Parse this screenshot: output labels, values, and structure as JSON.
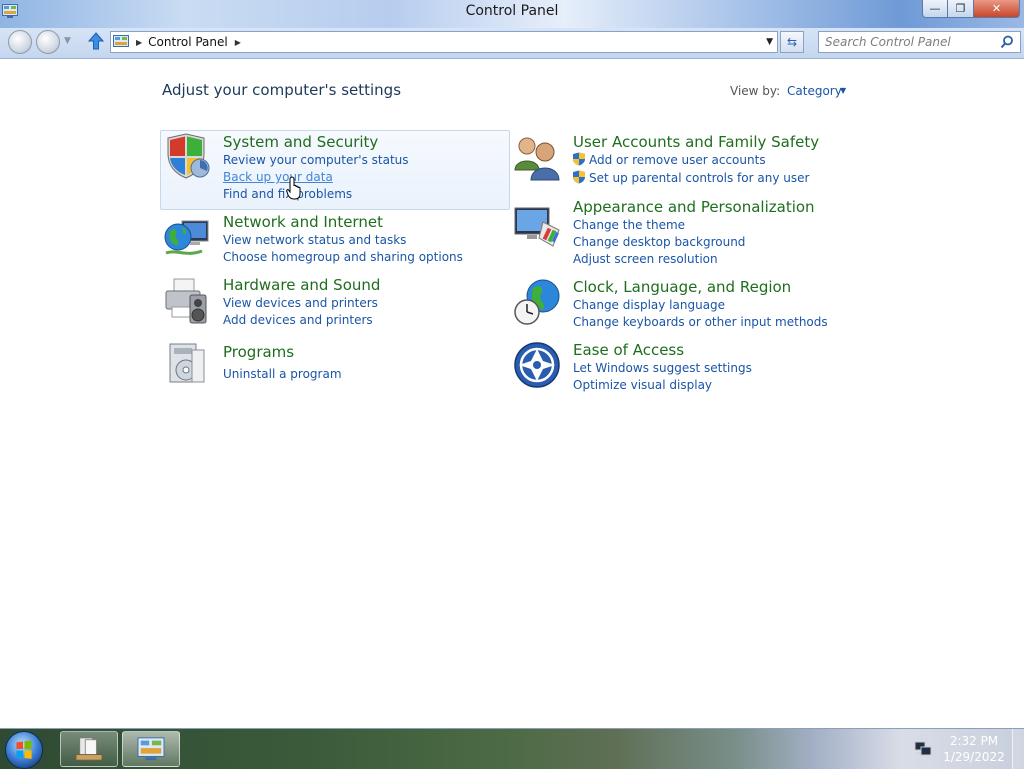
{
  "window": {
    "title": "Control Panel",
    "minimize": "—",
    "maximize": "❐",
    "close": "✕"
  },
  "address": {
    "crumb": "Control Panel",
    "search_placeholder": "Search Control Panel"
  },
  "content": {
    "heading": "Adjust your computer's settings",
    "view_by_label": "View by:",
    "view_by_value": "Category"
  },
  "categories": [
    {
      "title": "System and Security",
      "links": [
        "Review your computer's status",
        "Back up your data",
        "Find and fix problems"
      ]
    },
    {
      "title": "Network and Internet",
      "links": [
        "View network status and tasks",
        "Choose homegroup and sharing options"
      ]
    },
    {
      "title": "Hardware and Sound",
      "links": [
        "View devices and printers",
        "Add devices and printers"
      ]
    },
    {
      "title": "Programs",
      "links": [
        "Uninstall a program"
      ]
    },
    {
      "title": "User Accounts and Family Safety",
      "links": [
        "Add or remove user accounts",
        "Set up parental controls for any user"
      ]
    },
    {
      "title": "Appearance and Personalization",
      "links": [
        "Change the theme",
        "Change desktop background",
        "Adjust screen resolution"
      ]
    },
    {
      "title": "Clock, Language, and Region",
      "links": [
        "Change display language",
        "Change keyboards or other input methods"
      ]
    },
    {
      "title": "Ease of Access",
      "links": [
        "Let Windows suggest settings",
        "Optimize visual display"
      ]
    }
  ],
  "taskbar": {
    "time": "2:32 PM",
    "date": "1/29/2022"
  },
  "colors": {
    "category_title": "#1e6e1e",
    "link": "#1a55a7",
    "link_hover": "#3f86d8",
    "heading": "#1e395b"
  }
}
